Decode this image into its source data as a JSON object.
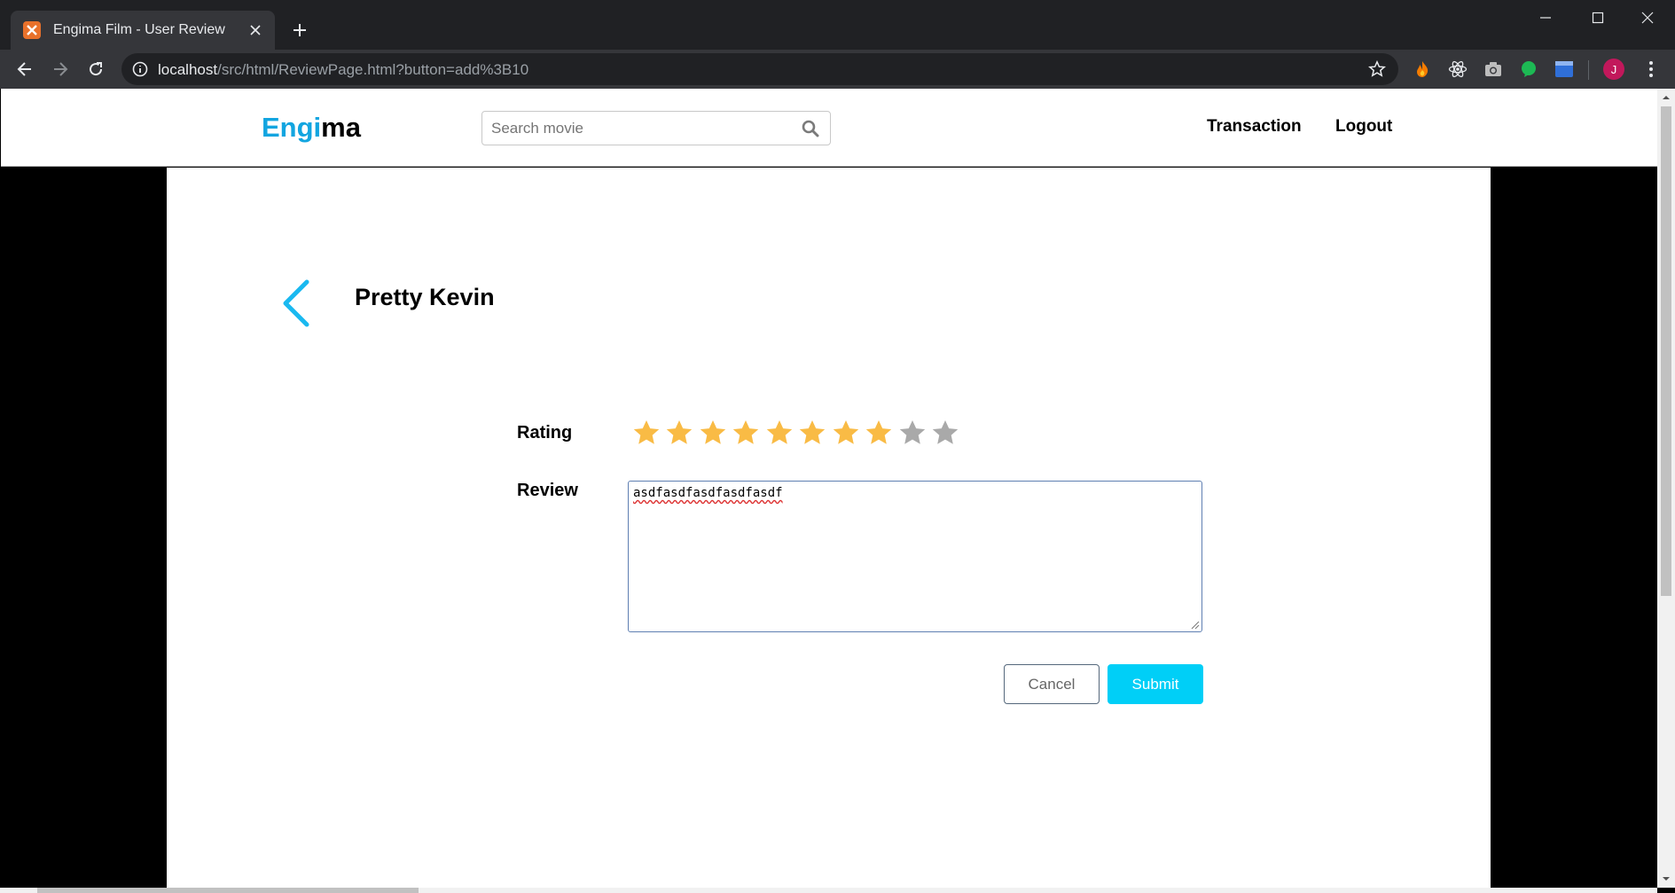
{
  "browser": {
    "tab_title": "Engima Film - User Review",
    "url_host": "localhost",
    "url_path": "/src/html/ReviewPage.html?button=add%3B10",
    "profile_initial": "J",
    "extensions": [
      "flame-icon",
      "react-icon",
      "camera-icon",
      "green-drop-icon",
      "window-icon"
    ]
  },
  "navbar": {
    "logo_part1": "Engi",
    "logo_part2": "ma",
    "search_placeholder": "Search movie",
    "links": [
      "Transaction",
      "Logout"
    ]
  },
  "review": {
    "movie_title": "Pretty Kevin",
    "rating_label": "Rating",
    "rating_value": 8,
    "rating_max": 10,
    "review_label": "Review",
    "review_text": "asdfasdfasdfasdfasdf",
    "cancel_label": "Cancel",
    "submit_label": "Submit"
  },
  "colors": {
    "brand_blue": "#12a5e0",
    "star_filled": "#f9bb45",
    "star_empty": "#a9a9a9",
    "submit_bg": "#00cff7"
  }
}
